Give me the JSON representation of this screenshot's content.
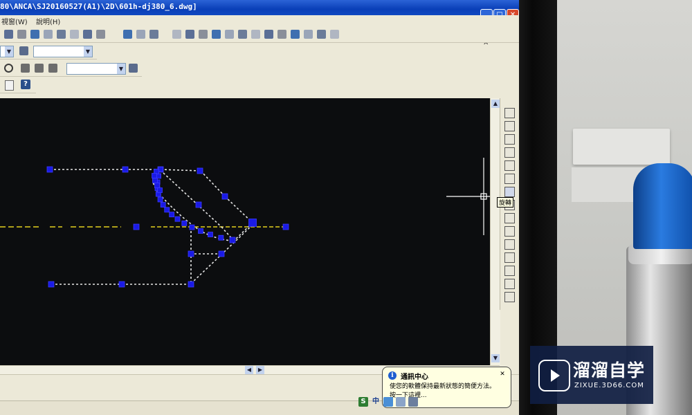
{
  "window": {
    "title": "80\\ANCA\\SJ20160527(A1)\\2D\\601h-dj380_6.dwg]",
    "minimize_glyph": "_",
    "maximize_glyph": "□",
    "close_glyph": "✕",
    "mdi_controls": "_ ⧉ ✕"
  },
  "menubar": {
    "items": [
      {
        "label": "視窗(W)"
      },
      {
        "label": "說明(H)"
      }
    ]
  },
  "toolbars": {
    "icons_row1": [
      "cube-front-icon",
      "cube-side-icon",
      "cube-top-icon",
      "cube-iso-icon",
      "sphere-icon",
      "cone-icon",
      "box-shade-icon",
      "orbit-icon",
      "align-icon",
      "distribute-icon",
      "shade-icon",
      "box-icon",
      "sphere2-icon",
      "cylinder-icon",
      "cone2-icon",
      "wedge-icon",
      "torus-icon",
      "union-icon",
      "subtract-icon",
      "extrude-icon",
      "revolve-icon",
      "slice-icon",
      "render-icon",
      "light-icon"
    ],
    "row2_combo_value": "",
    "row3_combo_value": "",
    "help_glyph": "?"
  },
  "drawing": {
    "background": "#0c0d0f",
    "grip_color": "#1a1ae6",
    "line_color": "#e6e6e6",
    "centerline_color": "#e3d11f",
    "crosshair_color": "#ffffff"
  },
  "right_toolbar": {
    "icons": [
      "erase-icon",
      "copy-icon",
      "mirror-icon",
      "offset-icon",
      "array-icon",
      "move-icon",
      "rotate-icon",
      "scale-icon",
      "stretch-icon",
      "trim-icon",
      "extend-icon",
      "break-icon",
      "chamfer-icon",
      "fillet-icon",
      "explode-icon"
    ],
    "tooltip": "旋轉"
  },
  "balloon": {
    "title": "通訊中心",
    "body": "使您的軟體保持最新狀態的簡便方法。",
    "body2": "按一下這裡...",
    "close_glyph": "✕",
    "info_glyph": "i"
  },
  "tray": {
    "s_glyph": "S",
    "ime_glyph": "中"
  },
  "watermark": {
    "brand": "溜溜自学",
    "url": "ZIXUE.3D66.COM"
  }
}
